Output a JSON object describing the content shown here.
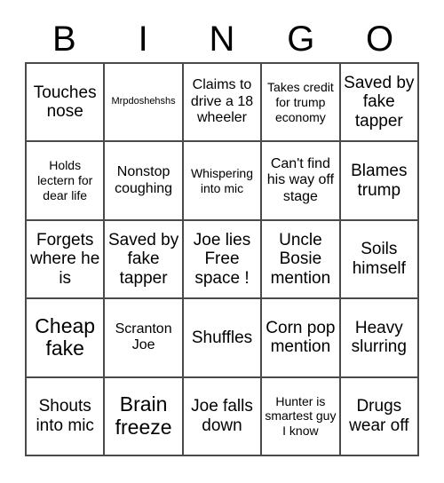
{
  "card": {
    "title": "BINGO",
    "header": {
      "letters": [
        "B",
        "I",
        "N",
        "G",
        "O"
      ]
    },
    "colors": {
      "border": "#4a4a4a",
      "text": "#000000",
      "background": "#ffffff"
    },
    "rows": [
      [
        {
          "text": "Touches nose",
          "size": "lg"
        },
        {
          "text": "Mrpdoshehshs",
          "size": "xs"
        },
        {
          "text": "Claims to drive a 18 wheeler",
          "size": "md"
        },
        {
          "text": "Takes credit for trump economy",
          "size": "sm"
        },
        {
          "text": "Saved by fake tapper",
          "size": "lg"
        }
      ],
      [
        {
          "text": "Holds lectern for dear life",
          "size": "sm"
        },
        {
          "text": "Nonstop coughing",
          "size": "md"
        },
        {
          "text": "Whispering into mic",
          "size": "sm"
        },
        {
          "text": "Can't find his way off stage",
          "size": "md"
        },
        {
          "text": "Blames trump",
          "size": "lg"
        }
      ],
      [
        {
          "text": "Forgets where he is",
          "size": "lg"
        },
        {
          "text": "Saved by fake tapper",
          "size": "lg"
        },
        {
          "text": "Joe lies Free space !",
          "size": "lg"
        },
        {
          "text": "Uncle Bosie mention",
          "size": "lg"
        },
        {
          "text": "Soils himself",
          "size": "lg"
        }
      ],
      [
        {
          "text": "Cheap fake",
          "size": "xl"
        },
        {
          "text": "Scranton Joe",
          "size": "md"
        },
        {
          "text": "Shuffles",
          "size": "lg"
        },
        {
          "text": "Corn pop mention",
          "size": "lg"
        },
        {
          "text": "Heavy slurring",
          "size": "lg"
        }
      ],
      [
        {
          "text": "Shouts into mic",
          "size": "lg"
        },
        {
          "text": "Brain freeze",
          "size": "xl"
        },
        {
          "text": "Joe falls down",
          "size": "lg"
        },
        {
          "text": "Hunter is smartest guy I know",
          "size": "sm"
        },
        {
          "text": "Drugs wear off",
          "size": "lg"
        }
      ]
    ]
  }
}
